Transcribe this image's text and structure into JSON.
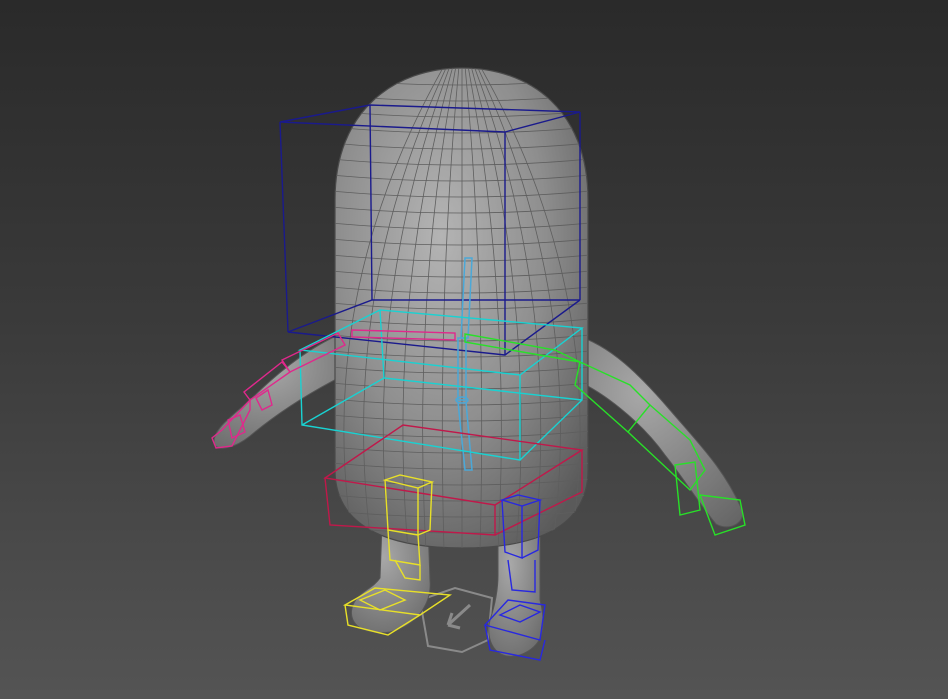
{
  "viewport": {
    "background_top": "#2a2a2a",
    "background_bottom": "#545454",
    "shading_mode": "shaded-with-wireframe"
  },
  "scene": {
    "character": {
      "icon": "character-mesh-icon",
      "mesh_color": "#8c8c8c",
      "wire_color": "#5e5e5e"
    },
    "rig_colors": {
      "head_bone": "#1a1a8c",
      "spine": "#19d2d2",
      "spine_bone": "#4aa8d8",
      "pelvis": "#c0184a",
      "left_arm": "#e0288c",
      "right_arm": "#28e028",
      "left_leg": "#e8e028",
      "right_leg": "#2828e0",
      "root_control": "#8a8a8a"
    }
  }
}
